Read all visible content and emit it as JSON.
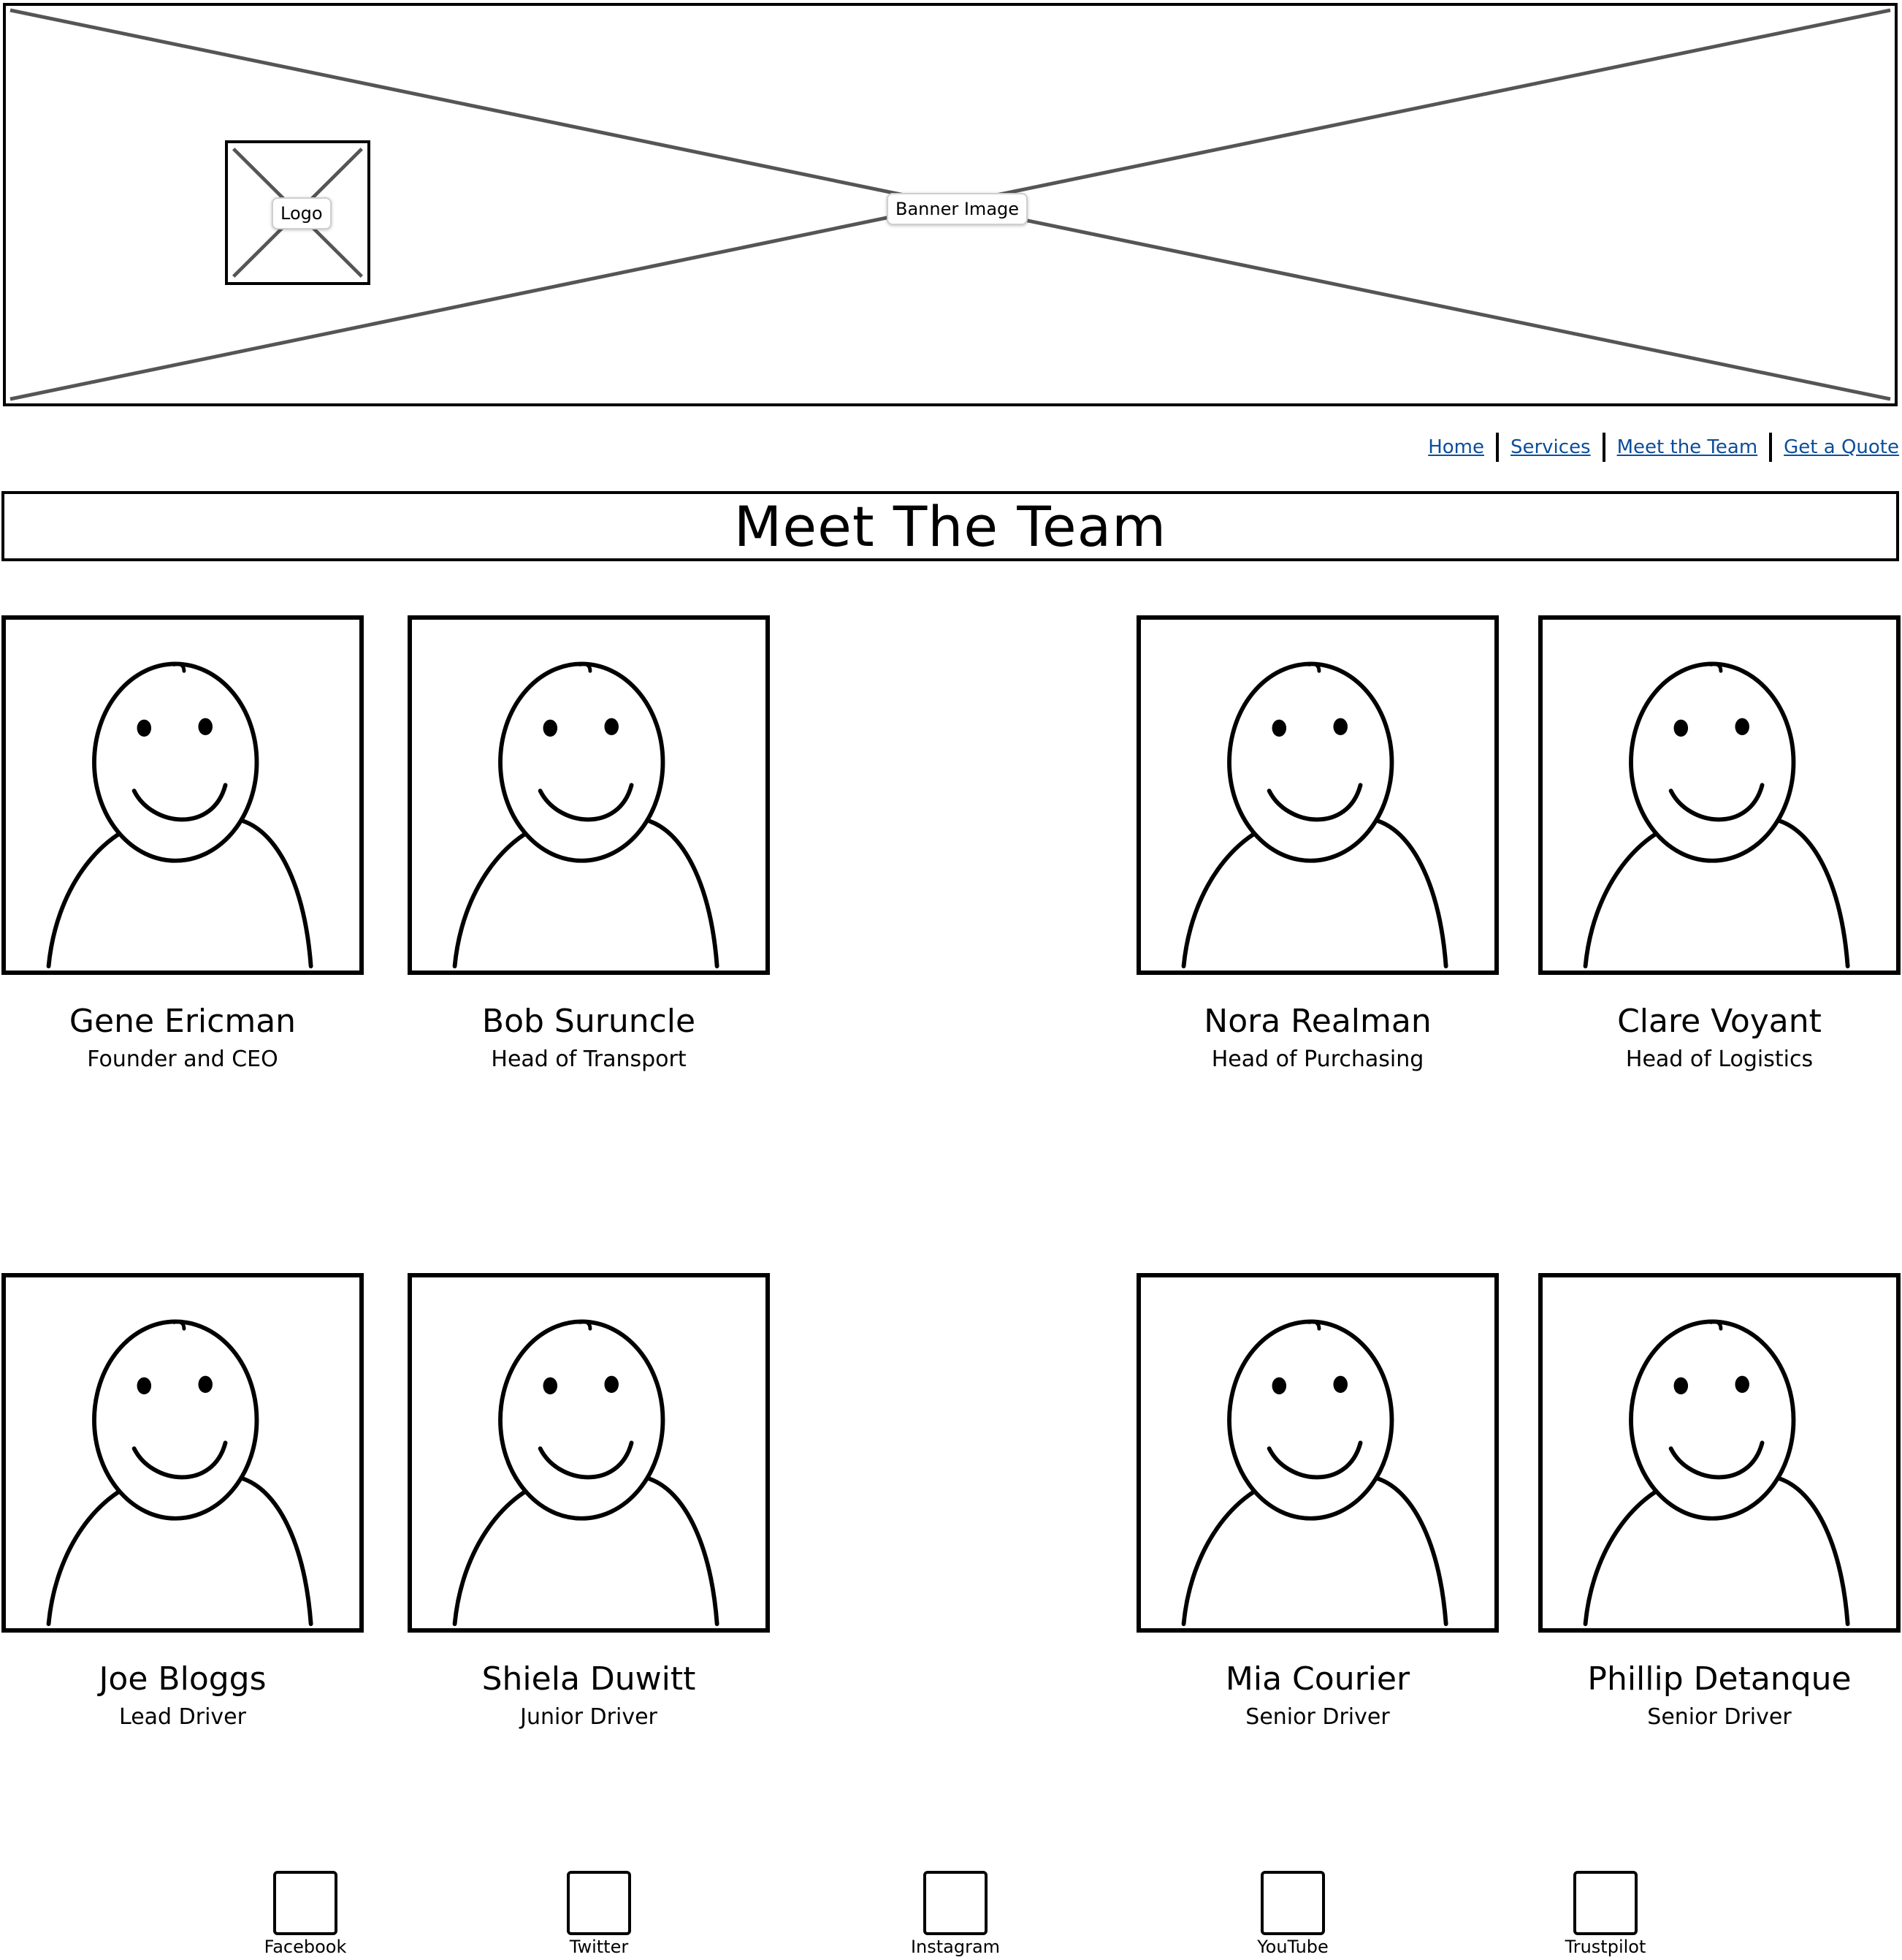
{
  "banner": {
    "label": "Banner Image"
  },
  "logo": {
    "label": "Logo"
  },
  "nav": {
    "links": [
      {
        "label": "Home"
      },
      {
        "label": "Services"
      },
      {
        "label": "Meet the Team"
      },
      {
        "label": "Get a Quote"
      }
    ]
  },
  "page": {
    "title": "Meet The Team"
  },
  "team": [
    {
      "name": "Gene Ericman",
      "role": "Founder and CEO"
    },
    {
      "name": "Bob Suruncle",
      "role": "Head of Transport"
    },
    {
      "name": "Nora Realman",
      "role": "Head of Purchasing"
    },
    {
      "name": "Clare Voyant",
      "role": "Head of Logistics"
    },
    {
      "name": "Joe Bloggs",
      "role": "Lead Driver"
    },
    {
      "name": "Shiela Duwitt",
      "role": "Junior Driver"
    },
    {
      "name": "Mia Courier",
      "role": "Senior Driver"
    },
    {
      "name": "Phillip Detanque",
      "role": "Senior Driver"
    }
  ],
  "footer": {
    "socials": [
      {
        "label": "Facebook",
        "icon": "facebook-icon"
      },
      {
        "label": "Twitter",
        "icon": "twitter-icon"
      },
      {
        "label": "Instagram",
        "icon": "instagram-icon"
      },
      {
        "label": "YouTube",
        "icon": "youtube-icon"
      },
      {
        "label": "Trustpilot",
        "icon": "trustpilot-icon"
      }
    ]
  },
  "colors": {
    "link": "#0b4e9a",
    "placeholder_line": "#555555"
  }
}
